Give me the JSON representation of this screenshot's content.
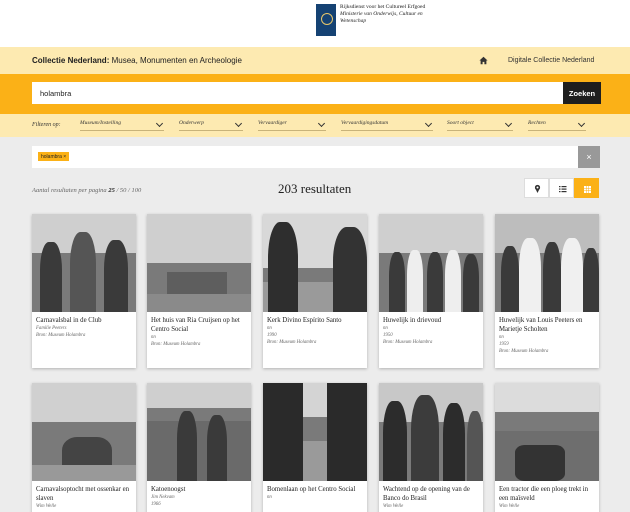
{
  "header": {
    "org_line1": "Rijksdienst voor het Cultureel Erfgoed",
    "org_line2": "Ministerie van Onderwijs, Cultuur en",
    "org_line3": "Wetenschap"
  },
  "titlebar": {
    "title_bold": "Collectie Nederland:",
    "title_rest": " Musea, Monumenten en Archeologie",
    "link": "Digitale Collectie Nederland"
  },
  "search": {
    "value": "holambra",
    "button": "Zoeken"
  },
  "filters": {
    "label": "Filteren op:",
    "items": [
      "Museum/Instelling",
      "Onderwerp",
      "Vervaardiger",
      "Vervaardigingsdatum",
      "Soort object",
      "Rechten"
    ]
  },
  "active_tag": {
    "label": "holambra",
    "remove": "×",
    "clear": "×"
  },
  "results": {
    "per_page_label": "Aantal resultaten per pagina",
    "opt1": "25",
    "sep1": " / ",
    "opt2": "50",
    "sep2": " / ",
    "opt3": "100",
    "count": "203 resultaten"
  },
  "cards": [
    {
      "title": "Carnavalsbal in de Club",
      "maker": "Familie Peeters",
      "date": "",
      "source": "Bron: Museum Holambra"
    },
    {
      "title": "Het huis van Ria Cruijsen op het Centro Social",
      "maker": "nn",
      "date": "",
      "source": "Bron: Museum Holambra"
    },
    {
      "title": "Kerk Divino Espírito Santo",
      "maker": "nn",
      "date": "1990",
      "source": "Bron: Museum Holambra"
    },
    {
      "title": "Huwelijk in drievoud",
      "maker": "nn",
      "date": "1950",
      "source": "Bron: Museum Holambra"
    },
    {
      "title": "Huwelijk van Louis Peeters en Marietje Scholten",
      "maker": "nn",
      "date": "1959",
      "source": "Bron: Museum Holambra"
    },
    {
      "title": "Carnavalsoptocht met ossenkar en slaven",
      "maker": "Wim Welle",
      "date": "",
      "source": ""
    },
    {
      "title": "Katoenoogst",
      "maker": "Jim Nekvam",
      "date": "1966",
      "source": ""
    },
    {
      "title": "Bomenlaan op het Centro Social",
      "maker": "nn",
      "date": "",
      "source": ""
    },
    {
      "title": "Wachtend op de opening van de Banco do Brasil",
      "maker": "Wim Welle",
      "date": "",
      "source": ""
    },
    {
      "title": "Een tractor die een ploeg trekt in een maïsveld",
      "maker": "Wim Welle",
      "date": "",
      "source": ""
    }
  ],
  "colors": {
    "accent": "#fbb117",
    "light": "#fdeab1",
    "dark": "#1e1e1e"
  }
}
